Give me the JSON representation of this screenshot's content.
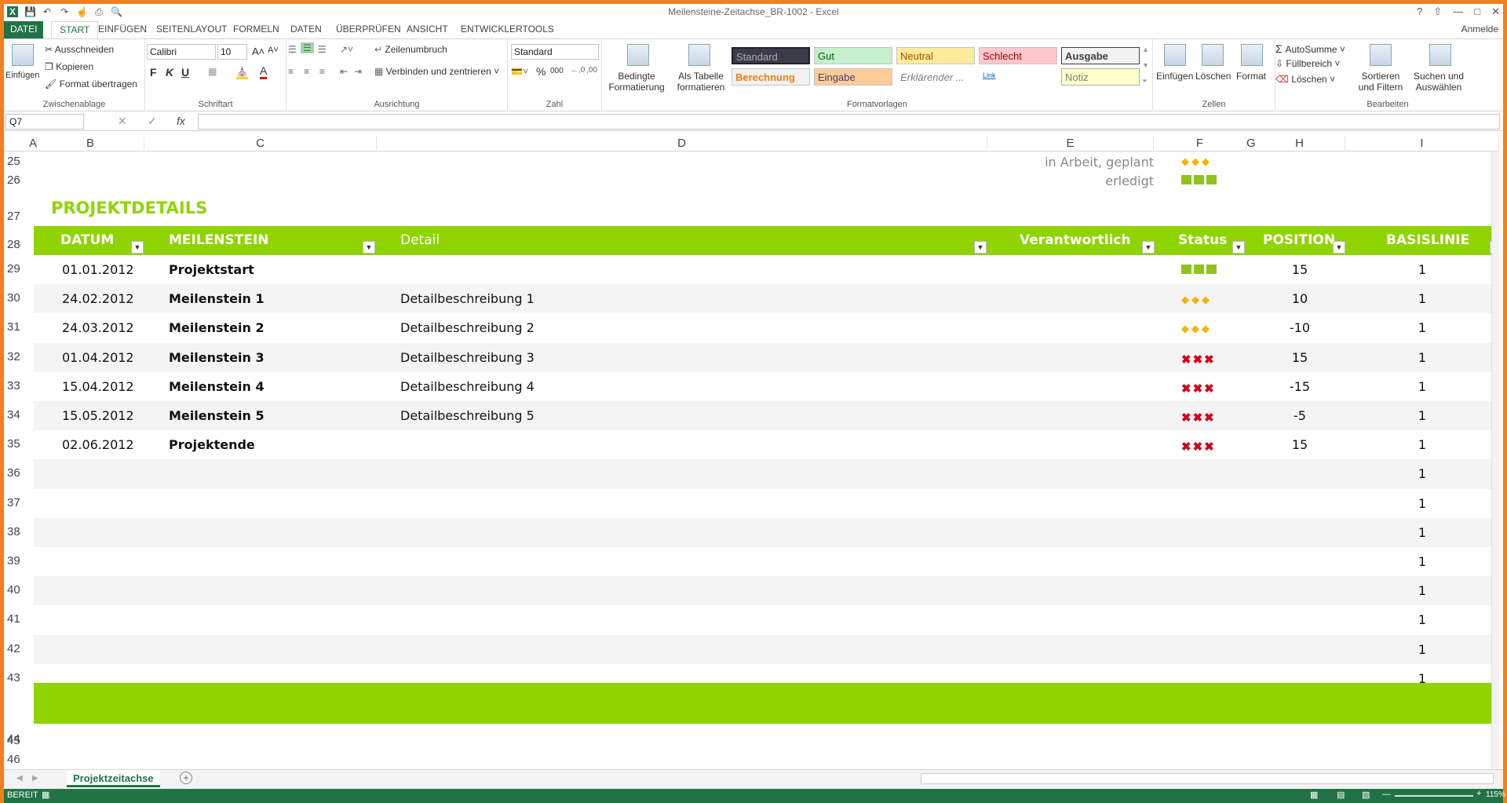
{
  "window": {
    "title": "Meilensteine-Zeitachse_BR-1002 - Excel",
    "user": "Anmelde"
  },
  "tabs": [
    "DATEI",
    "START",
    "EINFÜGEN",
    "SEITENLAYOUT",
    "FORMELN",
    "DATEN",
    "ÜBERPRÜFEN",
    "ANSICHT",
    "ENTWICKLERTOOLS"
  ],
  "ribbon": {
    "clipboard": {
      "paste": "Einfügen",
      "cut": "Ausschneiden",
      "copy": "Kopieren",
      "format_painter": "Format übertragen",
      "label": "Zwischenablage"
    },
    "font": {
      "name": "Calibri",
      "size": "10",
      "bold": "F",
      "italic": "K",
      "underline": "U",
      "label": "Schriftart"
    },
    "alignment": {
      "wrap": "Zeilenumbruch",
      "merge": "Verbinden und zentrieren",
      "label": "Ausrichtung"
    },
    "number": {
      "format": "Standard",
      "percent": "%",
      "thousands": "000",
      "label": "Zahl"
    },
    "cond_format": "Bedingte Formatierung",
    "as_table": "Als Tabelle formatieren",
    "styles": {
      "label": "Formatvorlagen",
      "standard": "Standard",
      "gut": "Gut",
      "neutral": "Neutral",
      "schlecht": "Schlecht",
      "ausgabe": "Ausgabe",
      "berechnung": "Berechnung",
      "eingabe": "Eingabe",
      "erklaerend": "Erklärender ...",
      "link": "Link",
      "notiz": "Notiz"
    },
    "cells": {
      "insert": "Einfügen",
      "delete": "Löschen",
      "format": "Format",
      "label": "Zellen"
    },
    "editing": {
      "autosum": "AutoSumme",
      "fill": "Füllbereich",
      "clear": "Löschen",
      "sort": "Sortieren und Filtern",
      "find": "Suchen und Auswählen",
      "label": "Bearbeiten"
    }
  },
  "formula_bar": {
    "name_box": "Q7",
    "fx": "fx",
    "value": ""
  },
  "columns": [
    "A",
    "B",
    "C",
    "D",
    "E",
    "F",
    "G",
    "H",
    "I"
  ],
  "legend": {
    "in_progress": "in Arbeit, geplant",
    "done": "erledigt"
  },
  "section_title": "PROJEKTDETAILS",
  "table_headers": {
    "datum": "DATUM",
    "meilenstein": "MEILENSTEIN",
    "detail": "Detail",
    "verantwortlich": "Verantwortlich",
    "status": "Status",
    "position": "POSITION",
    "basislinie": "BASISLINIE"
  },
  "rows": [
    {
      "row": "29",
      "datum": "01.01.2012",
      "meilenstein": "Projektstart",
      "detail": "",
      "status": "done",
      "position": "15",
      "basislinie": "1"
    },
    {
      "row": "30",
      "datum": "24.02.2012",
      "meilenstein": "Meilenstein 1",
      "detail": "Detailbeschreibung 1",
      "status": "in_progress",
      "position": "10",
      "basislinie": "1"
    },
    {
      "row": "31",
      "datum": "24.03.2012",
      "meilenstein": "Meilenstein 2",
      "detail": "Detailbeschreibung 2",
      "status": "in_progress",
      "position": "-10",
      "basislinie": "1"
    },
    {
      "row": "32",
      "datum": "01.04.2012",
      "meilenstein": "Meilenstein 3",
      "detail": "Detailbeschreibung 3",
      "status": "open",
      "position": "15",
      "basislinie": "1"
    },
    {
      "row": "33",
      "datum": "15.04.2012",
      "meilenstein": "Meilenstein 4",
      "detail": "Detailbeschreibung 4",
      "status": "open",
      "position": "-15",
      "basislinie": "1"
    },
    {
      "row": "34",
      "datum": "15.05.2012",
      "meilenstein": "Meilenstein 5",
      "detail": "Detailbeschreibung 5",
      "status": "open",
      "position": "-5",
      "basislinie": "1"
    },
    {
      "row": "35",
      "datum": "02.06.2012",
      "meilenstein": "Projektende",
      "detail": "",
      "status": "open",
      "position": "15",
      "basislinie": "1"
    }
  ],
  "empty_rows": [
    "36",
    "37",
    "38",
    "39",
    "40",
    "41",
    "42",
    "43"
  ],
  "empty_basislinie": "1",
  "other_rows": [
    "25",
    "26",
    "27",
    "28",
    "44",
    "45",
    "46"
  ],
  "sheet_tab": "Projektzeitachse",
  "status": {
    "mode": "BEREIT",
    "zoom": "115%"
  },
  "colors": {
    "accent_green": "#8fd400",
    "excel_green": "#217346",
    "border_orange": "#f07f1e"
  }
}
